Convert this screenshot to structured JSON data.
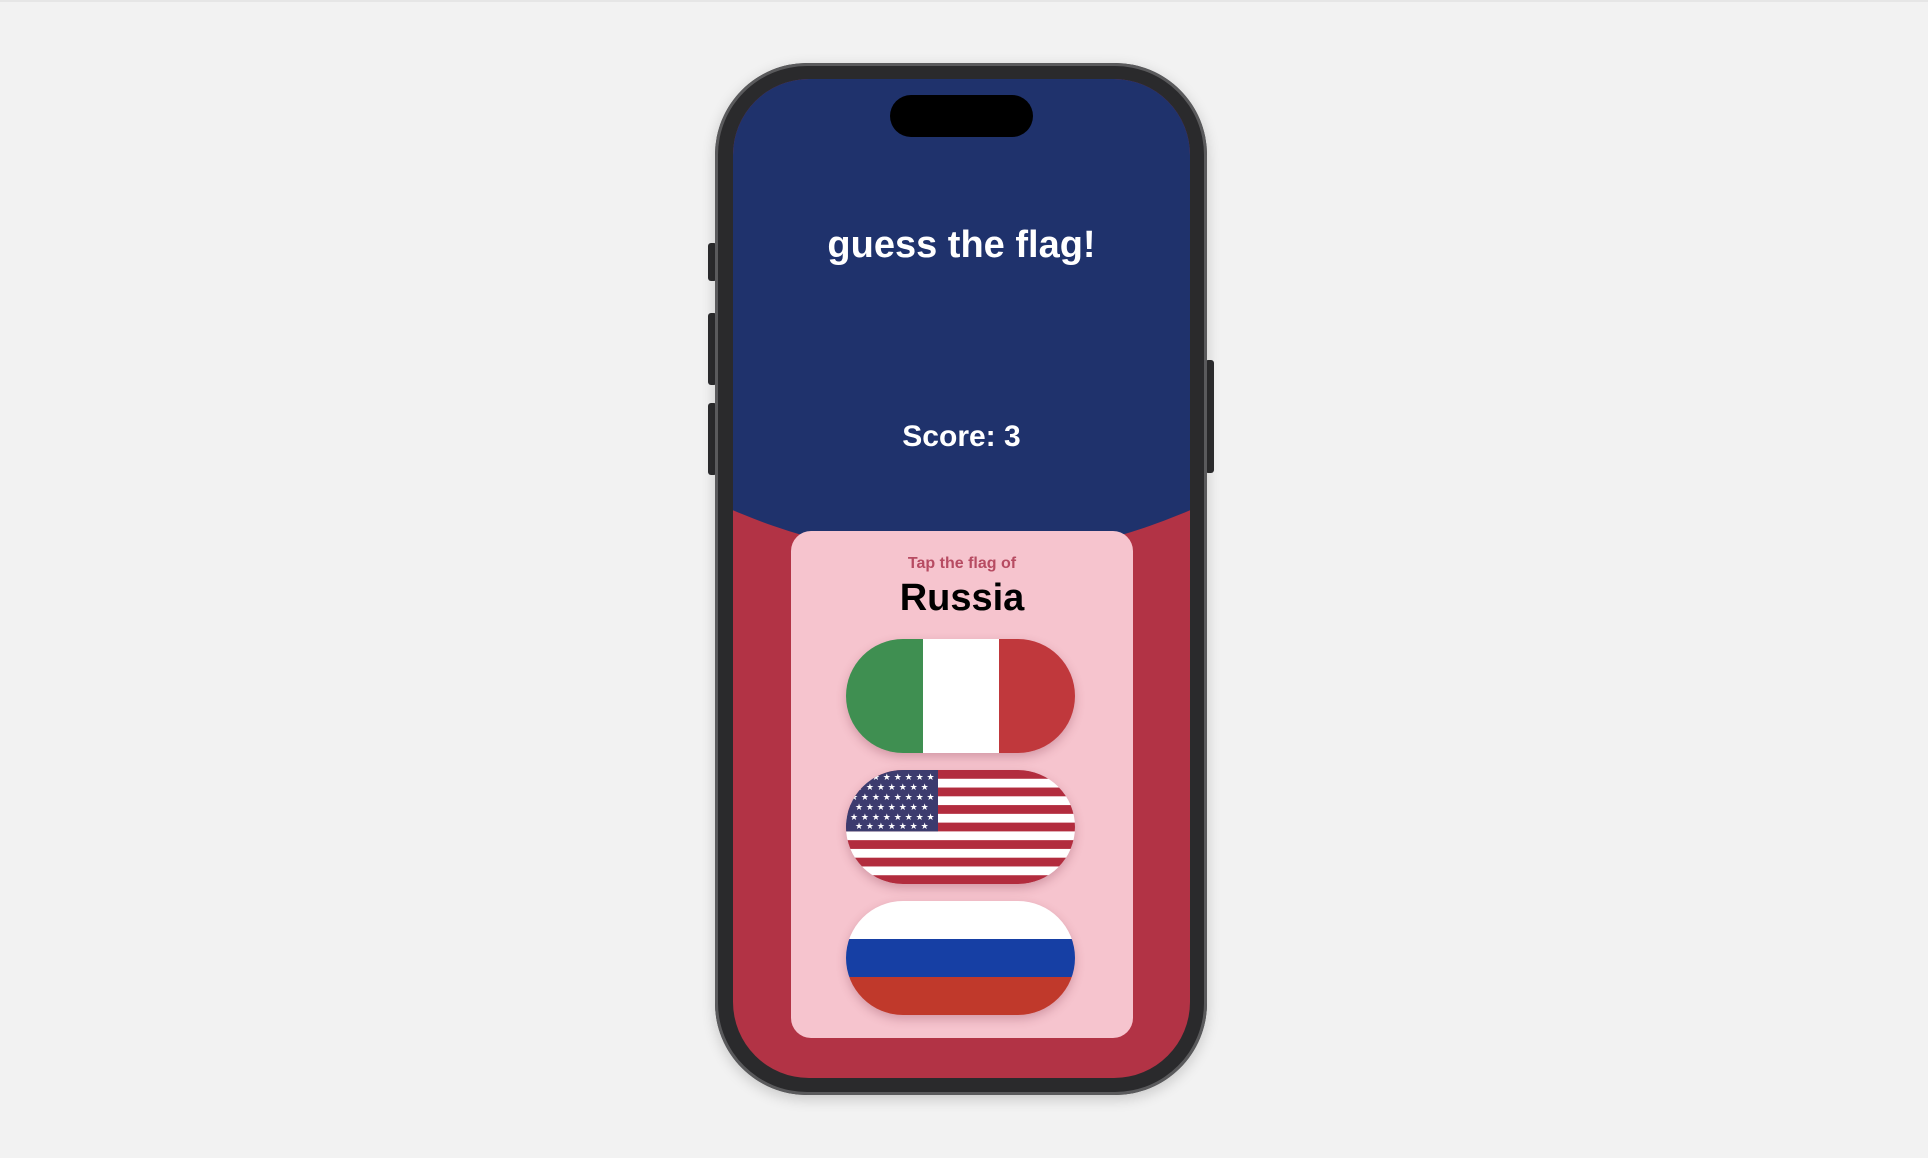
{
  "app": {
    "title": "guess the flag!",
    "score_text": "Score: 3"
  },
  "question": {
    "prompt": "Tap the flag of",
    "country": "Russia"
  },
  "flags": [
    {
      "country": "Italy",
      "icon": "italy-flag-icon"
    },
    {
      "country": "United States",
      "icon": "usa-flag-icon"
    },
    {
      "country": "Russia",
      "icon": "russia-flag-icon"
    }
  ],
  "colors": {
    "background": "#f2f2f2",
    "screen_top": "#1f326c",
    "screen_bottom": "#b23345",
    "card": "#f6c4ce",
    "prompt_text": "#b74b62"
  }
}
